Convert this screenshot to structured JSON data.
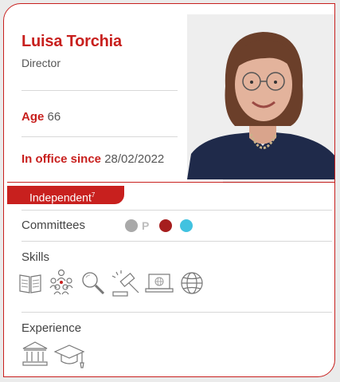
{
  "profile": {
    "name": "Luisa Torchia",
    "role": "Director",
    "age_label": "Age",
    "age_value": "66",
    "office_label": "In office since",
    "office_value": "28/02/2022"
  },
  "badge": {
    "label": "Independent",
    "footnote": "7"
  },
  "committees": {
    "label": "Committees",
    "items": [
      {
        "color": "#a9a9a9",
        "marker": "P"
      },
      {
        "color": "#a61e1e",
        "marker": ""
      },
      {
        "color": "#41c2e0",
        "marker": ""
      }
    ]
  },
  "skills": {
    "label": "Skills",
    "icons": [
      "book-icon",
      "team-icon",
      "magnifier-icon",
      "gavel-icon",
      "laptop-icon",
      "globe-icon"
    ]
  },
  "experience": {
    "label": "Experience",
    "icons": [
      "institution-icon",
      "graduation-cap-icon"
    ]
  },
  "colors": {
    "accent": "#c8201e",
    "text": "#555555",
    "divider": "#d8d8d8"
  }
}
